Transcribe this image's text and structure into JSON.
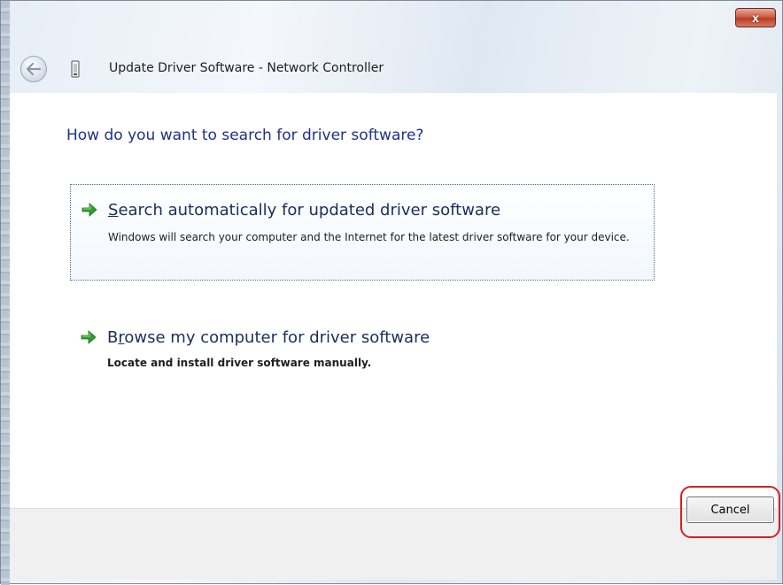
{
  "window": {
    "title": "Update Driver Software - Network Controller",
    "close_symbol": "x"
  },
  "page": {
    "heading": "How do you want to search for driver software?"
  },
  "options": [
    {
      "title_prefix": "",
      "title_accel": "S",
      "title_rest": "earch automatically for updated driver software",
      "description": "Windows will search your computer and the Internet for the latest driver software for your device.",
      "icon": "green-arrow-icon"
    },
    {
      "title_prefix": "B",
      "title_accel": "r",
      "title_rest": "owse my computer for driver software",
      "description": "Locate and install driver software manually.",
      "icon": "green-arrow-icon"
    }
  ],
  "footer": {
    "cancel_label": "Cancel"
  },
  "colors": {
    "heading": "#1e3287",
    "arrow": "#2e9e2e",
    "highlight": "#d62020"
  }
}
